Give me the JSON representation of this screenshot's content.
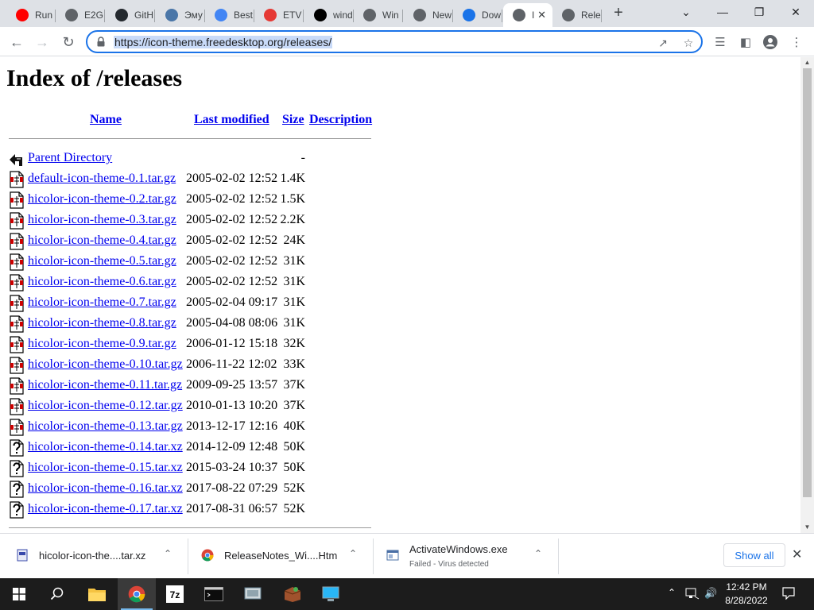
{
  "browser": {
    "tabs": [
      {
        "title": "Run",
        "icon": "youtube-icon",
        "color": "#ff0000"
      },
      {
        "title": "E2G",
        "icon": "globe-icon",
        "color": "#5f6368"
      },
      {
        "title": "GitH",
        "icon": "github-icon",
        "color": "#24292f"
      },
      {
        "title": "Эму",
        "icon": "4s-icon",
        "color": "#4a76a8"
      },
      {
        "title": "Best",
        "icon": "globe-icon",
        "color": "#4285f4"
      },
      {
        "title": "ETV",
        "icon": "block-icon",
        "color": "#e53935"
      },
      {
        "title": "wind",
        "icon": "letter-z-icon",
        "color": "#000000"
      },
      {
        "title": "Win",
        "icon": "globe-icon",
        "color": "#5f6368"
      },
      {
        "title": "New",
        "icon": "chrome-icon",
        "color": "#5f6368"
      },
      {
        "title": "Dow",
        "icon": "download-icon",
        "color": "#1a73e8"
      },
      {
        "title": "I",
        "icon": "globe-icon",
        "color": "#5f6368",
        "active": true
      },
      {
        "title": "Rele",
        "icon": "globe-icon",
        "color": "#5f6368"
      }
    ],
    "url": "https://icon-theme.freedesktop.org/releases/"
  },
  "page": {
    "title": "Index of /releases",
    "headers": {
      "name": "Name",
      "modified": "Last modified",
      "size": "Size",
      "description": "Description"
    },
    "parent": {
      "name": "Parent Directory",
      "size": "-"
    },
    "files": [
      {
        "name": "default-icon-theme-0.1.tar.gz",
        "modified": "2005-02-02 12:52",
        "size": "1.4K",
        "type": "compressed"
      },
      {
        "name": "hicolor-icon-theme-0.2.tar.gz",
        "modified": "2005-02-02 12:52",
        "size": "1.5K",
        "type": "compressed"
      },
      {
        "name": "hicolor-icon-theme-0.3.tar.gz",
        "modified": "2005-02-02 12:52",
        "size": "2.2K",
        "type": "compressed"
      },
      {
        "name": "hicolor-icon-theme-0.4.tar.gz",
        "modified": "2005-02-02 12:52",
        "size": "24K",
        "type": "compressed"
      },
      {
        "name": "hicolor-icon-theme-0.5.tar.gz",
        "modified": "2005-02-02 12:52",
        "size": "31K",
        "type": "compressed"
      },
      {
        "name": "hicolor-icon-theme-0.6.tar.gz",
        "modified": "2005-02-02 12:52",
        "size": "31K",
        "type": "compressed"
      },
      {
        "name": "hicolor-icon-theme-0.7.tar.gz",
        "modified": "2005-02-04 09:17",
        "size": "31K",
        "type": "compressed"
      },
      {
        "name": "hicolor-icon-theme-0.8.tar.gz",
        "modified": "2005-04-08 08:06",
        "size": "31K",
        "type": "compressed"
      },
      {
        "name": "hicolor-icon-theme-0.9.tar.gz",
        "modified": "2006-01-12 15:18",
        "size": "32K",
        "type": "compressed"
      },
      {
        "name": "hicolor-icon-theme-0.10.tar.gz",
        "modified": "2006-11-22 12:02",
        "size": "33K",
        "type": "compressed"
      },
      {
        "name": "hicolor-icon-theme-0.11.tar.gz",
        "modified": "2009-09-25 13:57",
        "size": "37K",
        "type": "compressed"
      },
      {
        "name": "hicolor-icon-theme-0.12.tar.gz",
        "modified": "2010-01-13 10:20",
        "size": "37K",
        "type": "compressed"
      },
      {
        "name": "hicolor-icon-theme-0.13.tar.gz",
        "modified": "2013-12-17 12:16",
        "size": "40K",
        "type": "compressed"
      },
      {
        "name": "hicolor-icon-theme-0.14.tar.xz",
        "modified": "2014-12-09 12:48",
        "size": "50K",
        "type": "unknown"
      },
      {
        "name": "hicolor-icon-theme-0.15.tar.xz",
        "modified": "2015-03-24 10:37",
        "size": "50K",
        "type": "unknown"
      },
      {
        "name": "hicolor-icon-theme-0.16.tar.xz",
        "modified": "2017-08-22 07:29",
        "size": "52K",
        "type": "unknown"
      },
      {
        "name": "hicolor-icon-theme-0.17.tar.xz",
        "modified": "2017-08-31 06:57",
        "size": "52K",
        "type": "unknown"
      }
    ]
  },
  "downloads": [
    {
      "name": "hicolor-icon-the....tar.xz",
      "status": "",
      "icon": "archive-file-icon"
    },
    {
      "name": "ReleaseNotes_Wi....Htm",
      "status": "",
      "icon": "chrome-icon"
    },
    {
      "name": "ActivateWindows.exe",
      "status": "Failed - Virus detected",
      "icon": "exe-file-icon"
    }
  ],
  "shelf": {
    "show_all": "Show all"
  },
  "taskbar": {
    "time": "12:42 PM",
    "date": "8/28/2022",
    "apps": [
      "start-icon",
      "search-icon",
      "file-explorer-icon",
      "chrome-icon",
      "7zip-icon",
      "terminal-icon",
      "network-icon",
      "package-icon",
      "computer-icon"
    ]
  }
}
